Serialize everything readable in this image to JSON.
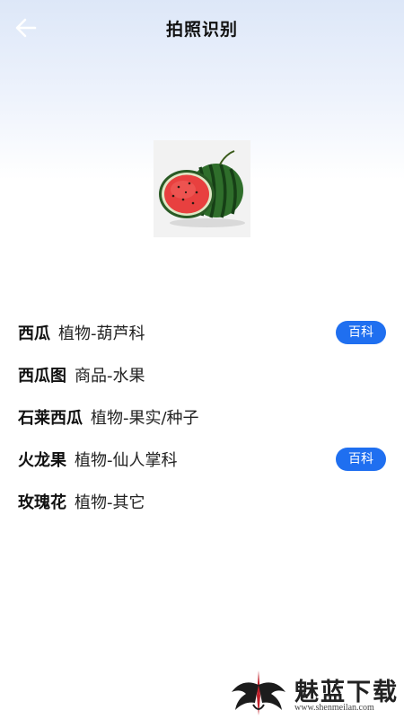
{
  "header": {
    "title": "拍照识别",
    "back_icon": "arrow-left-icon"
  },
  "photo": {
    "subject": "watermelon"
  },
  "results": [
    {
      "name": "西瓜",
      "category": "植物-葫芦科",
      "baike": "百科"
    },
    {
      "name": "西瓜图",
      "category": "商品-水果",
      "baike": null
    },
    {
      "name": "石莱西瓜",
      "category": "植物-果实/种子",
      "baike": null
    },
    {
      "name": "火龙果",
      "category": "植物-仙人掌科",
      "baike": "百科"
    },
    {
      "name": "玫瑰花",
      "category": "植物-其它",
      "baike": null
    }
  ],
  "watermark": {
    "text": "魅蓝下载",
    "url": "www.shenmeilan.com"
  },
  "colors": {
    "accent": "#1f6ff0",
    "background_top": "#dde7f8",
    "background": "#ffffff"
  }
}
